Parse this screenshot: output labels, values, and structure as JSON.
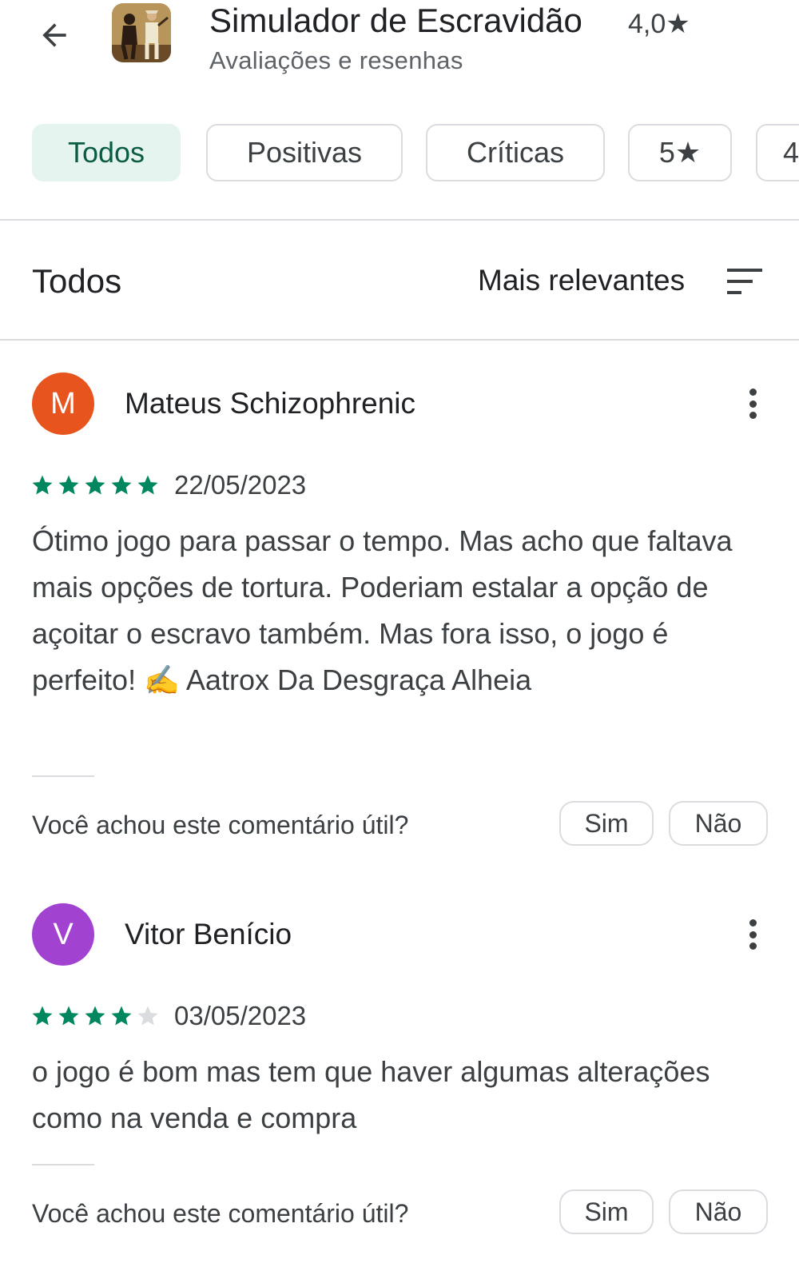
{
  "header": {
    "title": "Simulador de Escravidão",
    "rating": "4,0★",
    "subtitle": "Avaliações e resenhas"
  },
  "filters": {
    "chips": [
      "Todos",
      "Positivas",
      "Críticas",
      "5★",
      "4"
    ],
    "selected_index": 0
  },
  "list_header": {
    "title": "Todos",
    "sort_label": "Mais relevantes"
  },
  "reviews": [
    {
      "avatar_letter": "M",
      "avatar_color": "#e8541e",
      "name": "Mateus Schizophrenic",
      "stars": 5,
      "date": "22/05/2023",
      "text": "Ótimo jogo para passar o tempo. Mas acho que faltava mais opções de tortura. Poderiam estalar a opção de açoitar o escravo também. Mas fora isso, o jogo é perfeito! ✍️ Aatrox Da Desgraça Alheia",
      "helpful_question": "Você achou este comentário útil?",
      "yes_label": "Sim",
      "no_label": "Não"
    },
    {
      "avatar_letter": "V",
      "avatar_color": "#a142d0",
      "name": "Vitor Benício",
      "stars": 4,
      "date": "03/05/2023",
      "text": "o jogo é bom mas tem que haver algumas alterações como na venda e compra",
      "helpful_question": "Você achou este comentário útil?",
      "yes_label": "Sim",
      "no_label": "Não"
    }
  ],
  "colors": {
    "star_filled": "#01875f",
    "star_empty": "#dadce0",
    "chip_selected_bg": "#e6f4ef",
    "chip_selected_text": "#0b5c44"
  }
}
